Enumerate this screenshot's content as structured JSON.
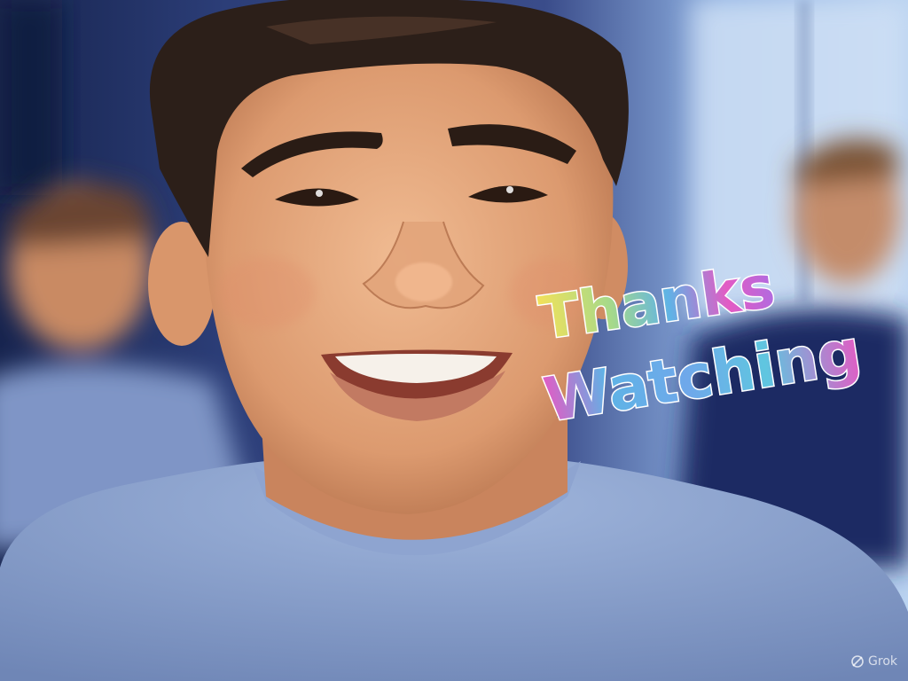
{
  "caption": {
    "line1": "Thanks",
    "line2": "Watching"
  },
  "watermark": {
    "text": "Grok",
    "icon": "grok-logo-icon"
  },
  "colors": {
    "sweater": "#8fa6cf",
    "skin": "#e4a77c",
    "hair": "#2e211b",
    "background_wall": "#2a3b7a",
    "window_light": "#c9dcf3",
    "caption_yellow": "#f2e15a",
    "caption_blue": "#5fb3e6",
    "caption_pink": "#e35bc4",
    "caption_purple": "#b06be0"
  }
}
